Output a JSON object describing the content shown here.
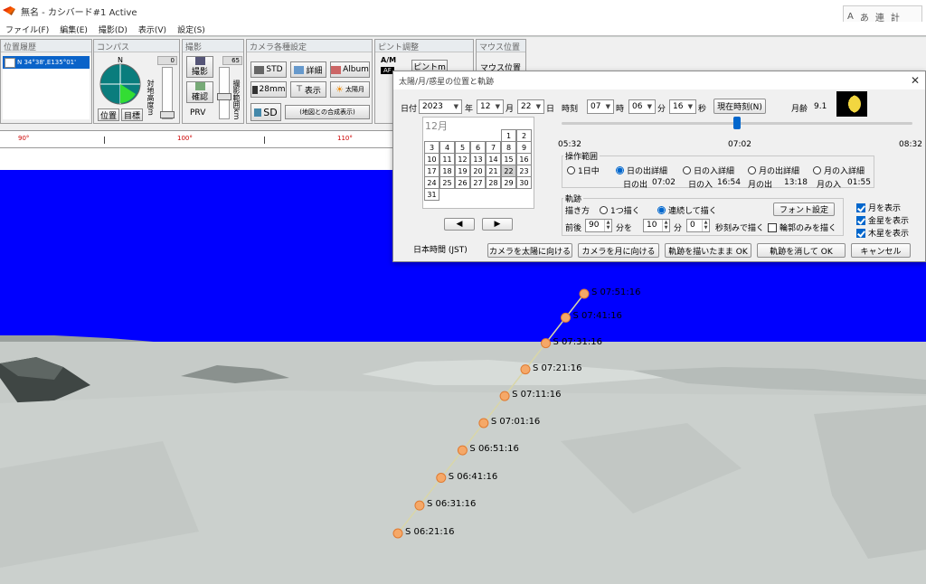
{
  "window": {
    "title": "無名 - カシバード#1 Active",
    "ime": [
      "A",
      "あ",
      "連",
      "計",
      "漢"
    ]
  },
  "menu": [
    "ファイル(F)",
    "編集(E)",
    "撮影(D)",
    "表示(V)",
    "設定(S)"
  ],
  "toolbar": {
    "position_panel": {
      "title": "位置履歴",
      "coord": "N 34°38',E135°01'"
    },
    "compass_panel": {
      "title": "コンパス",
      "north": "N",
      "btn_position": "位置",
      "btn_target": "目標",
      "altitude_label": "対地高度m",
      "slider_value": "0"
    },
    "shoot_panel": {
      "title": "撮影",
      "btn_shoot": "撮影",
      "btn_confirm": "確認",
      "btn_prv": "PRV",
      "range_label": "撮影範囲km",
      "slider_value": "65"
    },
    "camera_panel": {
      "title": "カメラ各種設定",
      "btn_std": "STD",
      "btn_detail": "詳細",
      "btn_album": "Album",
      "btn_28mm": "28mm",
      "btn_display": "表示",
      "btn_sun_moon": "太陽月",
      "btn_sd": "SD",
      "btn_composite": "(地図との合成表示)"
    },
    "focus_panel": {
      "title": "ピント調整",
      "am": "A/M",
      "af": "AF",
      "pinto": "ピントm"
    },
    "mouse_panel": {
      "title": "マウス位置",
      "label": "マウス位置"
    }
  },
  "ruler": {
    "labels": [
      "90°",
      "100°",
      "110°"
    ]
  },
  "sun_path": {
    "points": [
      {
        "label": "S 07:51:16"
      },
      {
        "label": "S 07:41:16"
      },
      {
        "label": "S 07:31:16"
      },
      {
        "label": "S 07:21:16"
      },
      {
        "label": "S 07:11:16"
      },
      {
        "label": "S 07:01:16"
      },
      {
        "label": "S 06:51:16"
      },
      {
        "label": "S 06:41:16"
      },
      {
        "label": "S 06:31:16"
      },
      {
        "label": "S 06:21:16"
      }
    ],
    "colors": {
      "sky": "#0000ff",
      "sun_dot": "#f5a868",
      "line": "#d9d6a8"
    }
  },
  "dialog": {
    "title": "太陽/月/惑星の位置と軌跡",
    "date_label": "日付",
    "year": "2023",
    "year_unit": "年",
    "month": "12",
    "month_unit": "月",
    "day": "22",
    "day_unit": "日",
    "time_label": "時刻",
    "hour": "07",
    "hour_unit": "時",
    "minute": "06",
    "minute_unit": "分",
    "second": "16",
    "second_unit": "秒",
    "now_button": "現在時刻(N)",
    "moon_age_label": "月齢",
    "moon_age": "9.1",
    "calendar": {
      "month_label": "12月",
      "days": [
        "",
        "",
        "",
        "",
        "",
        "1",
        "2",
        "3",
        "4",
        "5",
        "6",
        "7",
        "8",
        "9",
        "10",
        "11",
        "12",
        "13",
        "14",
        "15",
        "16",
        "17",
        "18",
        "19",
        "20",
        "21",
        "22",
        "23",
        "24",
        "25",
        "26",
        "27",
        "28",
        "29",
        "30",
        "31"
      ],
      "selected": "22"
    },
    "prev_button": "◀",
    "next_button": "▶",
    "timeline": {
      "start": "05:32",
      "current": "07:02",
      "end": "08:32",
      "position": 0.5
    },
    "range": {
      "title": "操作範囲",
      "options": [
        "1日中",
        "日の出詳細",
        "日の入詳細",
        "月の出詳細",
        "月の入詳細"
      ],
      "selected_index": 1,
      "sunrise_label": "日の出",
      "sunrise": "07:02",
      "sunset_label": "日の入",
      "sunset": "16:54",
      "moonrise_label": "月の出",
      "moonrise": "13:18",
      "moonset_label": "月の入",
      "moonset": "01:55"
    },
    "trail": {
      "title": "軌跡",
      "draw_label": "描き方",
      "draw_options": [
        "1つ描く",
        "連続して描く"
      ],
      "draw_selected": 1,
      "font_button": "フォント設定",
      "before_after_label": "前後",
      "before_after": "90",
      "minutes_every_label": "分を",
      "interval_min": "10",
      "min_label": "分",
      "interval_sec": "0",
      "sec_label": "秒刻みで描く",
      "outline_only": "輪郭のみを描く",
      "outline_only_checked": false
    },
    "checks": [
      {
        "label": "月を表示",
        "checked": true
      },
      {
        "label": "金星を表示",
        "checked": true
      },
      {
        "label": "木星を表示",
        "checked": true
      }
    ],
    "timezone": "日本時間 (JST)",
    "buttons": {
      "camera_sun": "カメラを太陽に向ける",
      "camera_moon": "カメラを月に向ける",
      "ok_keep": "軌跡を描いたまま OK",
      "ok_erase": "軌跡を消して OK",
      "cancel": "キャンセル"
    }
  }
}
